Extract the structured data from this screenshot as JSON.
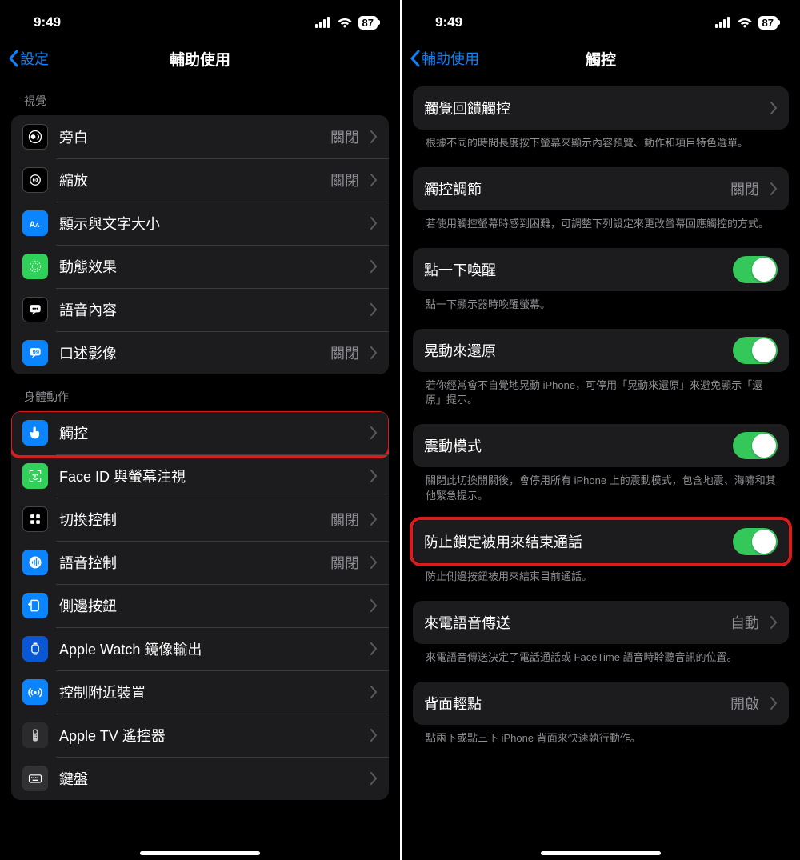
{
  "status": {
    "time": "9:49",
    "battery": "87"
  },
  "left": {
    "back": "設定",
    "title": "輔助使用",
    "groups": [
      {
        "header": "視覺",
        "rows": [
          {
            "icon": "voiceover",
            "label": "旁白",
            "value": "關閉"
          },
          {
            "icon": "zoom",
            "label": "縮放",
            "value": "關閉"
          },
          {
            "icon": "textsize",
            "label": "顯示與文字大小",
            "value": ""
          },
          {
            "icon": "motion",
            "label": "動態效果",
            "value": ""
          },
          {
            "icon": "speech",
            "label": "語音內容",
            "value": ""
          },
          {
            "icon": "audiodesc",
            "label": "口述影像",
            "value": "關閉"
          }
        ]
      },
      {
        "header": "身體動作",
        "rows": [
          {
            "icon": "touch",
            "label": "觸控",
            "value": ""
          },
          {
            "icon": "faceid",
            "label": "Face ID 與螢幕注視",
            "value": ""
          },
          {
            "icon": "switch",
            "label": "切換控制",
            "value": "關閉"
          },
          {
            "icon": "voicectl",
            "label": "語音控制",
            "value": "關閉"
          },
          {
            "icon": "sidebtn",
            "label": "側邊按鈕",
            "value": ""
          },
          {
            "icon": "watch",
            "label": "Apple Watch 鏡像輸出",
            "value": ""
          },
          {
            "icon": "nearby",
            "label": "控制附近裝置",
            "value": ""
          },
          {
            "icon": "appletv",
            "label": "Apple TV 遙控器",
            "value": ""
          },
          {
            "icon": "keyboard",
            "label": "鍵盤",
            "value": ""
          }
        ]
      }
    ]
  },
  "right": {
    "back": "輔助使用",
    "title": "觸控",
    "sections": [
      {
        "label": "觸覺回饋觸控",
        "type": "nav",
        "value": "",
        "footer": "根據不同的時間長度按下螢幕來顯示內容預覽、動作和項目特色選單。"
      },
      {
        "label": "觸控調節",
        "type": "nav",
        "value": "關閉",
        "footer": "若使用觸控螢幕時感到困難，可調整下列設定來更改螢幕回應觸控的方式。"
      },
      {
        "label": "點一下喚醒",
        "type": "toggle",
        "on": true,
        "footer": "點一下顯示器時喚醒螢幕。"
      },
      {
        "label": "晃動來還原",
        "type": "toggle",
        "on": true,
        "footer": "若你經常會不自覺地晃動 iPhone，可停用「晃動來還原」來避免顯示「還原」提示。"
      },
      {
        "label": "震動模式",
        "type": "toggle",
        "on": true,
        "footer": "關閉此切換開關後，會停用所有 iPhone 上的震動模式，包含地震、海嘯和其他緊急提示。"
      },
      {
        "label": "防止鎖定被用來結束通話",
        "type": "toggle",
        "on": true,
        "footer": "防止側邊按鈕被用來結束目前通話。",
        "highlight": true
      },
      {
        "label": "來電語音傳送",
        "type": "nav",
        "value": "自動",
        "footer": "來電語音傳送決定了電話通話或 FaceTime 語音時聆聽音訊的位置。"
      },
      {
        "label": "背面輕點",
        "type": "nav",
        "value": "開啟",
        "footer": "點兩下或點三下 iPhone 背面來快速執行動作。"
      }
    ]
  }
}
